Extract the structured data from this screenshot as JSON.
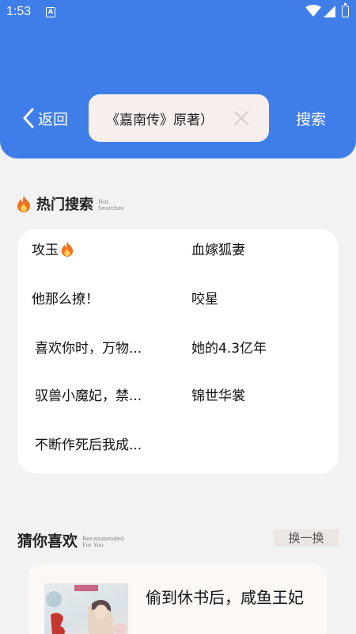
{
  "status_bar": {
    "time": "1:53",
    "notification_letter": "A"
  },
  "header": {
    "back_label": "返回",
    "search_value": "《嘉南传》原著）",
    "search_button": "搜索"
  },
  "hot_searches": {
    "title": "热门搜索",
    "subtitle_line1": "Hot",
    "subtitle_line2": "Searches",
    "items": [
      {
        "label": "攻玉",
        "hot": true
      },
      {
        "label": "血嫁狐妻"
      },
      {
        "label": "他那么撩！"
      },
      {
        "label": "咬星"
      },
      {
        "label": "喜欢你时，万物..."
      },
      {
        "label": "她的4.3亿年"
      },
      {
        "label": "驭兽小魔妃，禁..."
      },
      {
        "label": "锦世华裳"
      },
      {
        "label": "不断作死后我成..."
      }
    ]
  },
  "recommend": {
    "title": "猜你喜欢",
    "subtitle_line1": "Recommended",
    "subtitle_line2": "For You",
    "refresh_label": "换一换",
    "book": {
      "title": "偷到休书后，咸鱼王妃"
    }
  },
  "colors": {
    "header_blue": "#3f7ee9",
    "fire": "#f2711c"
  }
}
